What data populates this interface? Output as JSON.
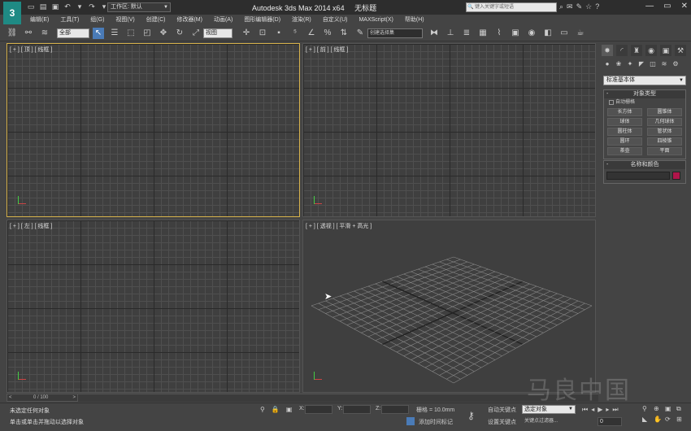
{
  "window": {
    "title": "Autodesk 3ds Max  2014 x64",
    "document": "无标题",
    "workspace": "工作区: 默认",
    "search_placeholder": "键入关键字或短语"
  },
  "menus": [
    "编辑(E)",
    "工具(T)",
    "组(G)",
    "视图(V)",
    "创建(C)",
    "修改器(M)",
    "动画(A)",
    "图形编辑器(D)",
    "渲染(R)",
    "自定义(U)",
    "MAXScript(X)",
    "帮助(H)"
  ],
  "toolbar": {
    "selection_filter": "全部",
    "reference_coord": "视图",
    "named_selection": "创建选择集"
  },
  "viewports": {
    "top": "[ + ] [ 顶 ] [ 线框 ]",
    "front": "[ + ] [ 前 ] [ 线框 ]",
    "left": "[ + ] [ 左 ] [ 线框 ]",
    "perspective": "[ + ] [ 透视 ] [ 平滑 + 高光 ]"
  },
  "command_panel": {
    "category": "标准基本体",
    "object_type_title": "对象类型",
    "autogrid_label": "自动栅格",
    "objects": [
      "长方体",
      "圆锥体",
      "球体",
      "几何球体",
      "圆柱体",
      "管状体",
      "圆环",
      "四棱锥",
      "茶壶",
      "平面"
    ],
    "name_color_title": "名称和颜色",
    "object_name": "",
    "color": "#b0154a"
  },
  "timeline": {
    "frame_display": "0 / 100",
    "prev": "<",
    "next": ">"
  },
  "status": {
    "message1": "未选定任何对象",
    "message2": "单击或单击并拖动以选择对象",
    "x_label": "X:",
    "y_label": "Y:",
    "z_label": "Z:",
    "grid": "栅格 = 10.0mm",
    "add_time_tag": "添加时间标记",
    "auto_key": "自动关键点",
    "set_key": "设置关键点",
    "key_filter_select": "选定对象",
    "key_filters": "关键点过滤器...",
    "current_frame": "0"
  },
  "watermark": "马良中国"
}
